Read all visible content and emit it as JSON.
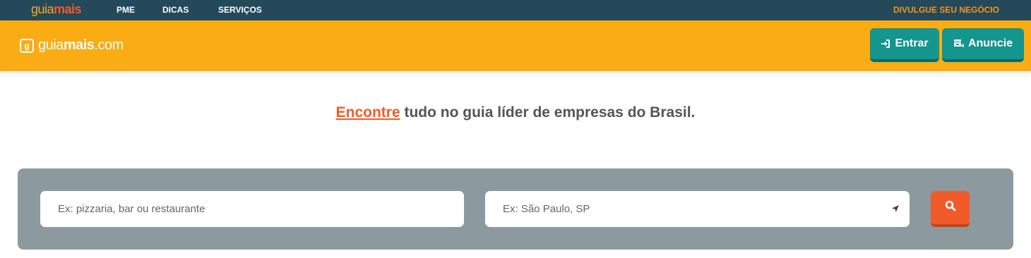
{
  "topbar": {
    "logo_part1": "guia",
    "logo_part2": "mais",
    "nav": [
      {
        "label": "PME"
      },
      {
        "label": "DICAS"
      },
      {
        "label": "SERVIÇOS"
      }
    ],
    "cta": "DIVULGUE SEU NEGÓCIO"
  },
  "header": {
    "brand_badge": "g",
    "brand_part1": "guia",
    "brand_part2": "mais",
    "brand_part3": ".com",
    "entrar_label": "Entrar",
    "anuncie_label": "Anuncie"
  },
  "headline": {
    "emphasis": "Encontre",
    "rest": " tudo no guia líder de empresas do Brasil."
  },
  "search": {
    "what_placeholder": "Ex: pizzaria, bar ou restaurante",
    "where_placeholder": "Ex: São Paulo, SP"
  },
  "colors": {
    "topbar_bg": "#23495a",
    "header_bg": "#faac14",
    "button_teal": "#14958d",
    "accent_orange": "#f15b29",
    "panel_gray": "#8c9a9f"
  },
  "icons": {
    "login": "sign-in-icon",
    "anuncie": "storefront-plus-icon",
    "location": "location-arrow-icon",
    "search": "search-icon"
  }
}
